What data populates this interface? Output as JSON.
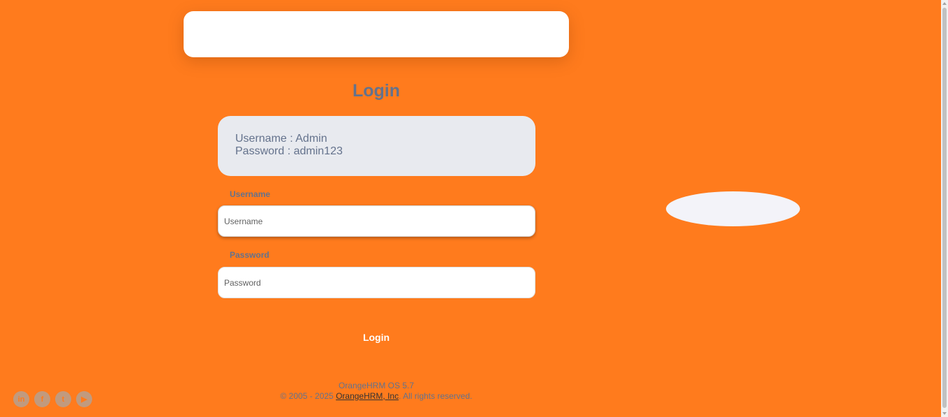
{
  "login": {
    "title": "Login",
    "credentials": {
      "username_line": "Username : Admin",
      "password_line": "Password : admin123"
    },
    "username_label": "Username",
    "username_placeholder": "Username",
    "password_label": "Password",
    "password_placeholder": "Password",
    "submit_label": "Login"
  },
  "footer": {
    "version": "OrangeHRM OS 5.7",
    "copyright_prefix": "© 2005 - 2025 ",
    "company_link": "OrangeHRM, Inc",
    "copyright_suffix": ". All rights reserved."
  },
  "social": [
    {
      "icon": "linkedin-icon",
      "glyph": "in"
    },
    {
      "icon": "facebook-icon",
      "glyph": "f"
    },
    {
      "icon": "twitter-icon",
      "glyph": "t"
    },
    {
      "icon": "youtube-icon",
      "glyph": "▶"
    }
  ],
  "colors": {
    "background": "#ff7b1d",
    "text": "#64728c",
    "credential_box": "#e8eaef"
  }
}
